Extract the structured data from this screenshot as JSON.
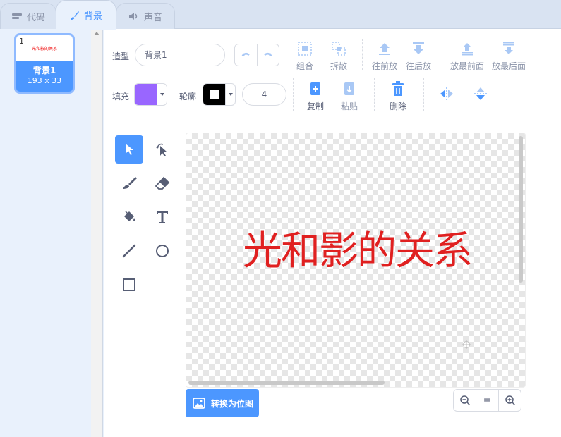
{
  "tabs": [
    {
      "label": "代码",
      "icon": "code-icon",
      "active": false
    },
    {
      "label": "背景",
      "icon": "brush-icon",
      "active": true
    },
    {
      "label": "声音",
      "icon": "speaker-icon",
      "active": false
    }
  ],
  "backdrop_list": {
    "items": [
      {
        "number": "1",
        "thumb_text": "光和影的关系",
        "name": "背景1",
        "size": "193 x 33"
      }
    ]
  },
  "editor": {
    "name_label": "造型",
    "name_value": "背景1",
    "fill_label": "填充",
    "fill_color": "#9966ff",
    "outline_label": "轮廓",
    "outline_color": "#000000",
    "outline_width": "4",
    "group_label": "组合",
    "ungroup_label": "拆散",
    "forward_label": "往前放",
    "backward_label": "往后放",
    "front_label": "放最前面",
    "back_label": "放最后面",
    "copy_label": "复制",
    "paste_label": "粘贴",
    "delete_label": "删除",
    "canvas_text": "光和影的关系",
    "convert_label": "转换为位图",
    "accent_color": "#4c97ff",
    "zoom_reset": "="
  }
}
